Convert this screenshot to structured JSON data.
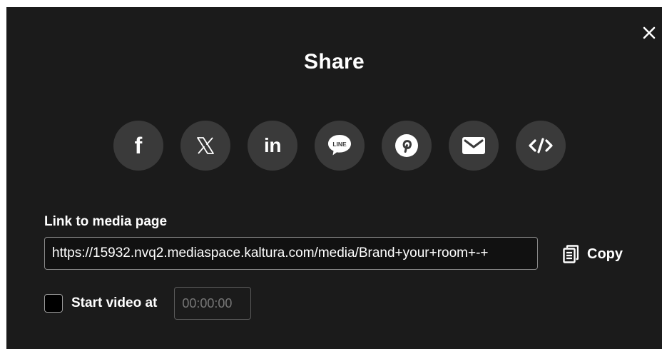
{
  "dialog": {
    "title": "Share",
    "close_icon": "close-icon"
  },
  "social": [
    {
      "name": "facebook",
      "glyph": "f",
      "icon": "facebook-icon"
    },
    {
      "name": "x",
      "icon": "x-icon"
    },
    {
      "name": "linkedin",
      "glyph": "in",
      "icon": "linkedin-icon"
    },
    {
      "name": "line",
      "glyph": "LINE",
      "icon": "line-icon"
    },
    {
      "name": "pinterest",
      "icon": "pinterest-icon"
    },
    {
      "name": "email",
      "icon": "email-icon"
    },
    {
      "name": "embed",
      "icon": "embed-code-icon"
    }
  ],
  "link": {
    "label": "Link to media page",
    "value": "https://15932.nvq2.mediaspace.kaltura.com/media/Brand+your+room+-+"
  },
  "copy": {
    "label": "Copy",
    "icon": "copy-icon"
  },
  "start": {
    "label": "Start video at",
    "checked": false,
    "placeholder": "00:00:00"
  },
  "colors": {
    "modal_bg": "#1b1b1b",
    "button_bg": "#3a3a3a",
    "text": "#ffffff"
  }
}
